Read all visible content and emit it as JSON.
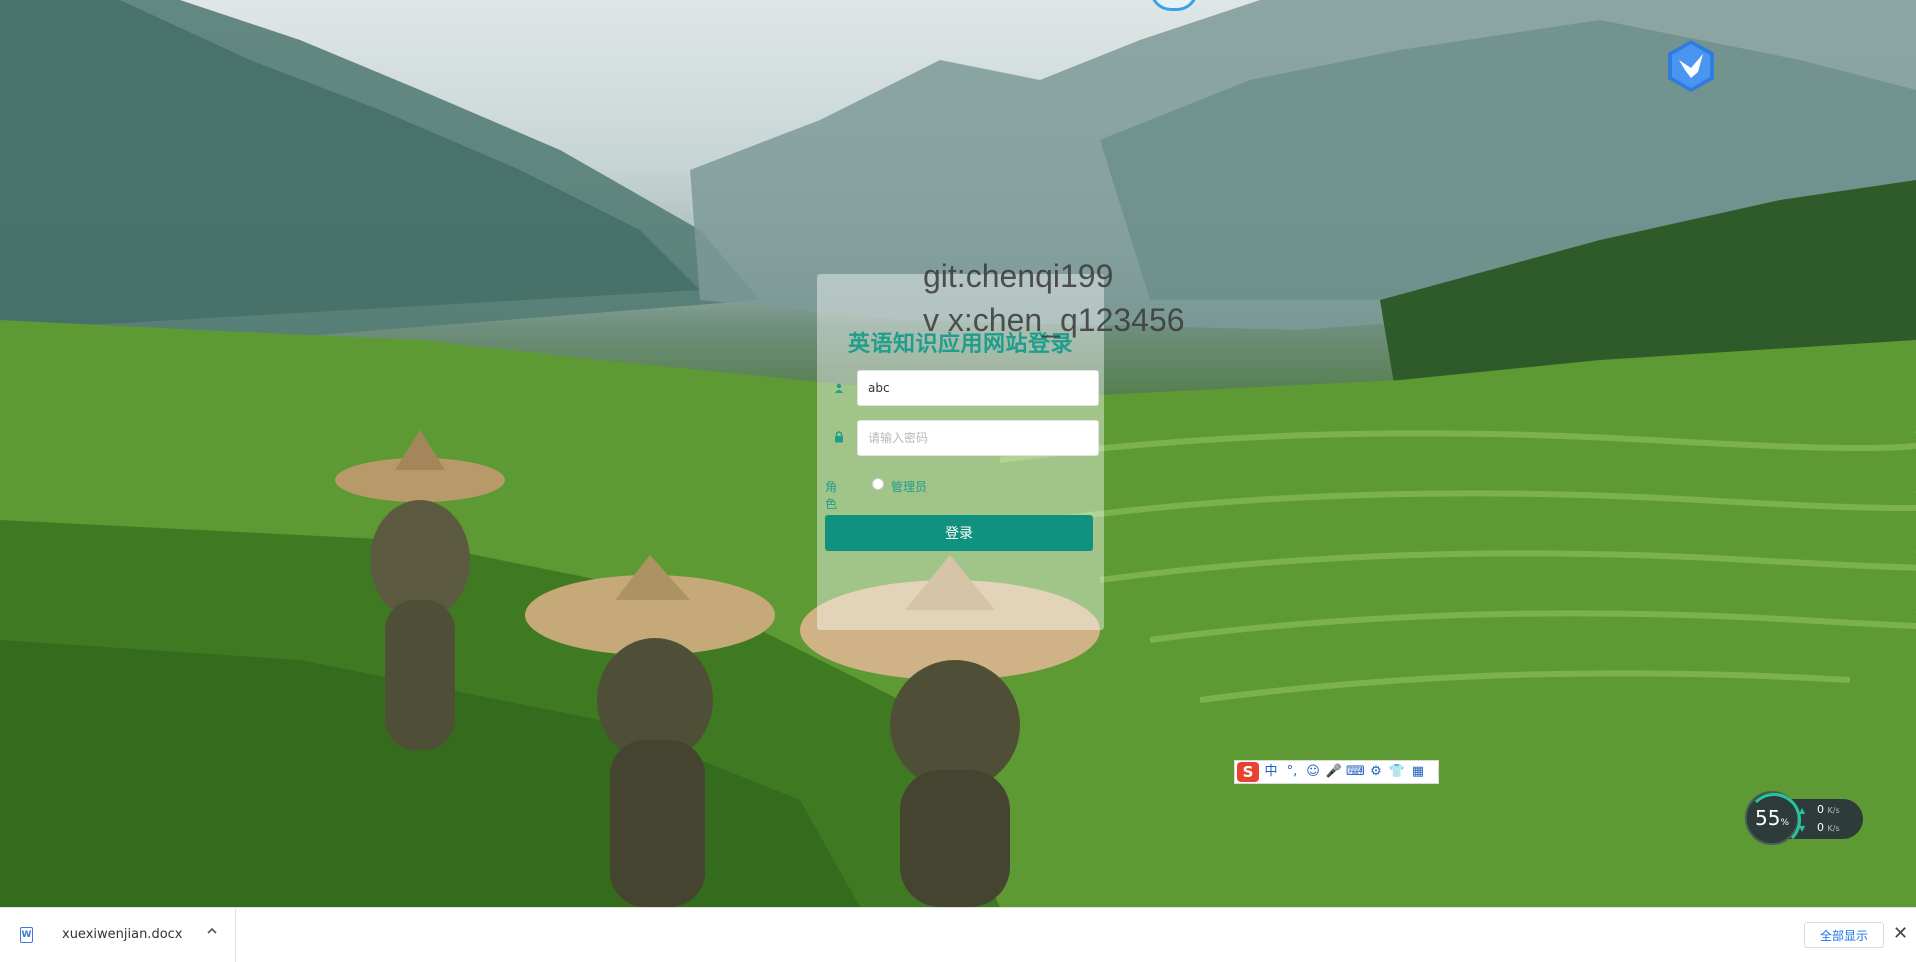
{
  "watermark": {
    "line1": "git:chenqi199",
    "line2": "v x:chen_q123456"
  },
  "login": {
    "title": "英语知识应用网站登录",
    "username_value": "abc",
    "password_placeholder": "请输入密码",
    "role_label": "角色",
    "role_option": "管理员",
    "role_checked": false,
    "submit_label": "登录",
    "accent_color": "#11917f"
  },
  "ime_toolbar": {
    "logo": "S",
    "items": [
      "中",
      "°,",
      "☺",
      "🎤",
      "⌨",
      "⚙",
      "👕",
      "▦"
    ]
  },
  "net_monitor": {
    "percent": "55",
    "percent_unit": "%",
    "up_speed": "0",
    "down_speed": "0",
    "speed_unit": "K/s"
  },
  "download_bar": {
    "file_name": "xuexiwenjian.docx",
    "file_icon": "W",
    "show_all_label": "全部显示",
    "close_label": "✕"
  }
}
